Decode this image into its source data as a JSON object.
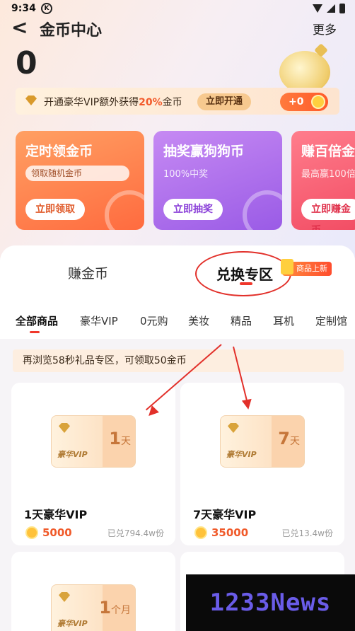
{
  "status": {
    "time": "9:34",
    "k": "K"
  },
  "header": {
    "back": "<",
    "title": "金币中心",
    "more": "更多"
  },
  "balance": "0",
  "vip_bar": {
    "prefix": "开通豪华VIP额外获得",
    "highlight": "20%",
    "suffix": "金币",
    "button": "立即开通"
  },
  "bonus": "+0",
  "cards": [
    {
      "title": "定时领金币",
      "subtitle": "领取随机金币",
      "button": "立即领取"
    },
    {
      "title": "抽奖赢狗狗币",
      "subtitle": "100%中奖",
      "button": "立即抽奖"
    },
    {
      "title": "赚百倍金",
      "subtitle": "最高赢100倍",
      "button": "立即赚金币"
    }
  ],
  "main_tabs": [
    {
      "label": "赚金币"
    },
    {
      "label": "兑换专区"
    }
  ],
  "new_badge": "商品上新",
  "categories": [
    "全部商品",
    "豪华VIP",
    "0元购",
    "美妆",
    "精品",
    "耳机",
    "定制馆"
  ],
  "notice": "再浏览58秒礼品专区，可领取50金币",
  "products": [
    {
      "card_label": "豪华VIP",
      "days": "1",
      "unit": "天",
      "name": "1天豪华VIP",
      "price": "5000",
      "sold": "已兑794.4w份"
    },
    {
      "card_label": "豪华VIP",
      "days": "7",
      "unit": "天",
      "name": "7天豪华VIP",
      "price": "35000",
      "sold": "已兑13.4w份"
    },
    {
      "card_label": "豪华VIP",
      "days": "1",
      "unit": "个月"
    }
  ],
  "watermark": "1233News"
}
